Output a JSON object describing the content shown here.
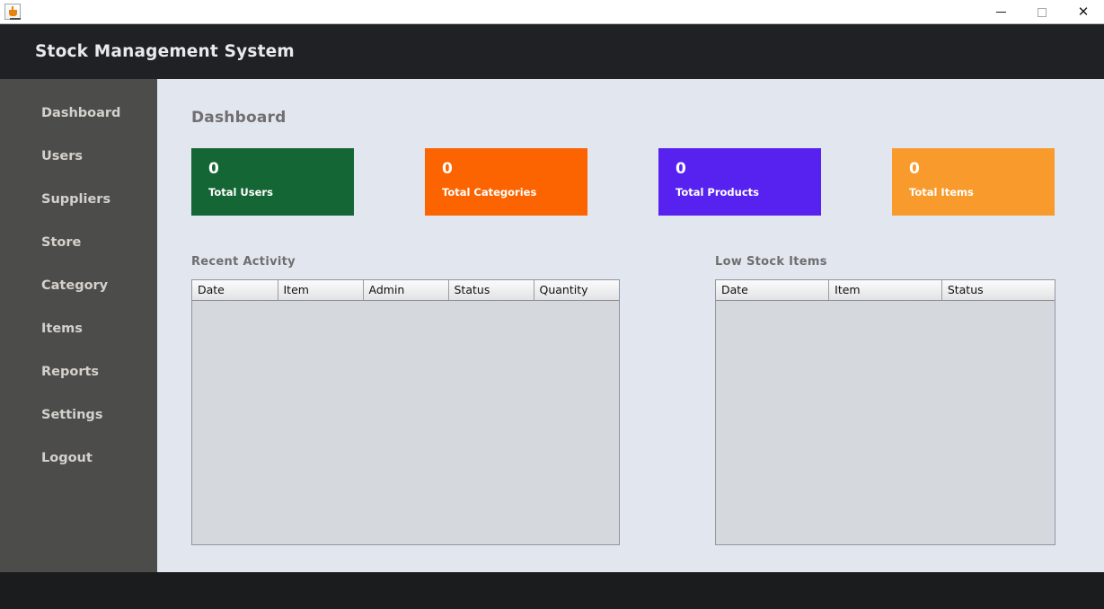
{
  "window": {
    "app_icon": "java-coffee-cup-icon",
    "minimize_label": "—",
    "maximize_label": "□",
    "close_label": "✕"
  },
  "header": {
    "title": "Stock Management System",
    "background": "#1f2124"
  },
  "sidebar": {
    "background": "#4c4c4a",
    "items": [
      {
        "label": "Dashboard",
        "name": "dashboard"
      },
      {
        "label": "Users",
        "name": "users"
      },
      {
        "label": "Suppliers",
        "name": "suppliers"
      },
      {
        "label": "Store",
        "name": "store"
      },
      {
        "label": "Category",
        "name": "category"
      },
      {
        "label": "Items",
        "name": "items"
      },
      {
        "label": "Reports",
        "name": "reports"
      },
      {
        "label": "Settings",
        "name": "settings"
      },
      {
        "label": "Logout",
        "name": "logout"
      }
    ]
  },
  "main": {
    "page_title": "Dashboard",
    "background": "#e2e6ee",
    "cards": [
      {
        "value": "0",
        "label": "Total Users",
        "color": "#156635"
      },
      {
        "value": "0",
        "label": "Total Categories",
        "color": "#fb6400"
      },
      {
        "value": "0",
        "label": "Total Products",
        "color": "#5722f0"
      },
      {
        "value": "0",
        "label": "Total Items",
        "color": "#f99b2c"
      }
    ],
    "recent_activity": {
      "title": "Recent Activity",
      "columns": [
        "Date",
        "Item",
        "Admin",
        "Status",
        "Quantity"
      ],
      "rows": []
    },
    "low_stock": {
      "title": "Low Stock Items",
      "columns": [
        "Date",
        "Item",
        "Status"
      ],
      "rows": []
    }
  }
}
